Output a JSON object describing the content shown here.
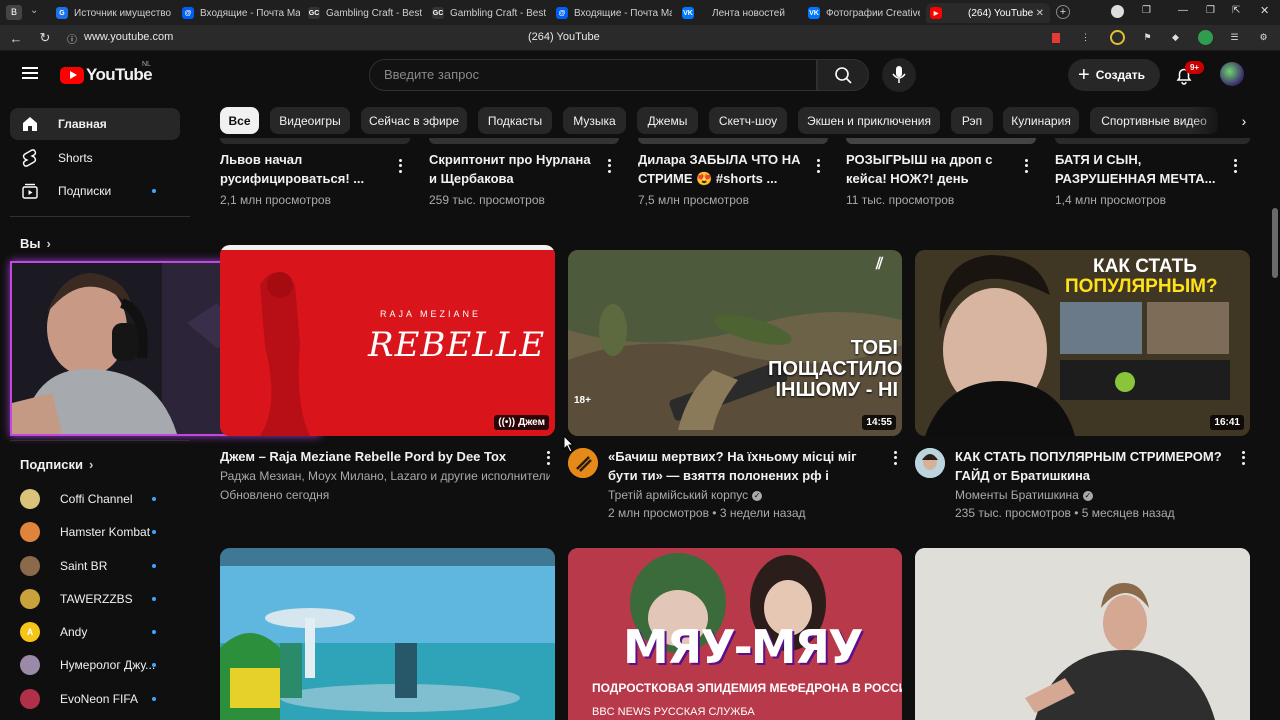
{
  "browser": {
    "tabs": [
      {
        "label": "Источник имущество",
        "favicon": "G",
        "color": "#1a73e8"
      },
      {
        "label": "Входящие - Почта Mail",
        "favicon": "@",
        "color": "#005ff9"
      },
      {
        "label": "Gambling Craft - Best c",
        "favicon": "GC",
        "color": "#333333"
      },
      {
        "label": "Gambling Craft - Best c",
        "favicon": "GC",
        "color": "#333333"
      },
      {
        "label": "Входящие - Почта Mail",
        "favicon": "@",
        "color": "#005ff9"
      },
      {
        "label": "Лента новостей",
        "favicon": "VK",
        "color": "#0077ff"
      },
      {
        "label": "Фотографии Creative C",
        "favicon": "VK",
        "color": "#0077ff"
      },
      {
        "label": "(264) YouTube",
        "favicon": "▶",
        "color": "#ff0000"
      }
    ],
    "url": "www.youtube.com",
    "page_title": "(264) YouTube"
  },
  "header": {
    "logo_text": "YouTube",
    "logo_region": "NL",
    "search_placeholder": "Введите запрос",
    "create_label": "Создать",
    "notifications_badge": "9+"
  },
  "sidebar": {
    "nav": [
      {
        "label": "Главная",
        "icon": "home-icon"
      },
      {
        "label": "Shorts",
        "icon": "shorts-icon"
      },
      {
        "label": "Подписки",
        "icon": "subscriptions-icon"
      }
    ],
    "you_label": "Вы",
    "subscriptions_label": "Подписки",
    "subscriptions": [
      {
        "name": "Coffi Channel",
        "color": "#d9c27a",
        "initial": ""
      },
      {
        "name": "Hamster Kombat",
        "color": "#e0843b",
        "initial": ""
      },
      {
        "name": "Saint BR",
        "color": "#8a6a4a",
        "initial": ""
      },
      {
        "name": "TAWERZZBS",
        "color": "#c9a23c",
        "initial": ""
      },
      {
        "name": "Andy",
        "color": "#f5c518",
        "initial": "A"
      },
      {
        "name": "Нумеролог Джу...",
        "color": "#9a8aa8",
        "initial": ""
      },
      {
        "name": "EvoNeon FIFA",
        "color": "#b0304a",
        "initial": ""
      }
    ]
  },
  "chips": [
    "Все",
    "Видеоигры",
    "Сейчас в эфире",
    "Подкасты",
    "Музыка",
    "Джемы",
    "Скетч-шоу",
    "Экшен и приключения",
    "Рэп",
    "Кулинария",
    "Спортивные видео"
  ],
  "shorts_row": [
    {
      "title": "Львов начал русифицироваться! ...",
      "views": "2,1 млн просмотров"
    },
    {
      "title": "Скриптонит про Нурлана и Щербакова",
      "views": "259 тыс. просмотров"
    },
    {
      "title": "Дилара ЗАБЫЛА ЧТО НА СТРИМЕ 😍 #shorts ...",
      "views": "7,5 млн просмотров"
    },
    {
      "title": "РОЗЫГРЫШ на дроп с кейса! НОЖ?! день",
      "views": "11 тыс. просмотров"
    },
    {
      "title": "БАТЯ И СЫН, РАЗРУШЕННАЯ МЕЧТА...",
      "views": "1,4 млн просмотров"
    }
  ],
  "videos": [
    {
      "title": "Джем – Raja Meziane  Rebelle  Pord by Dee Tox",
      "channel": "Раджа Мезиан, Моух Милано, Lazaro и другие исполнители",
      "meta": "Обновлено сегодня",
      "badge": "Джем",
      "thumb_artist": "RAJA MEZIANE",
      "thumb_title": "REBELLE"
    },
    {
      "title": "«Бачиш мертвих? На їхньому місці міг бути ти» — взяття полонених рф і контрудар ...",
      "channel": "Третій армійський корпус",
      "meta": "2 млн просмотров • 3 недели назад",
      "duration": "14:55",
      "age": "18+",
      "thumb_text": "ТОБІ ПОЩАСТИЛО ІНШОМУ - НІ"
    },
    {
      "title": "КАК СТАТЬ ПОПУЛЯРНЫМ СТРИМЕРОМ? ГАЙД от Братишкина",
      "channel": "Моменты Братишкина",
      "meta": "235 тыс. просмотров • 5 месяцев назад",
      "duration": "16:41",
      "thumb_title_1": "КАК СТАТЬ",
      "thumb_title_2": "ПОПУЛЯРНЫМ?"
    },
    {
      "thumb": "mobile-game"
    },
    {
      "thumb_title": "МЯУ-МЯУ",
      "thumb_subtitle": "ПОДРОСТКОВАЯ ЭПИДЕМИЯ МЕФЕДРОНА В РОССИИ",
      "thumb_footer": "BBC NEWS РУССКАЯ СЛУЖБА"
    },
    {
      "thumb": "person-at-desk"
    }
  ]
}
